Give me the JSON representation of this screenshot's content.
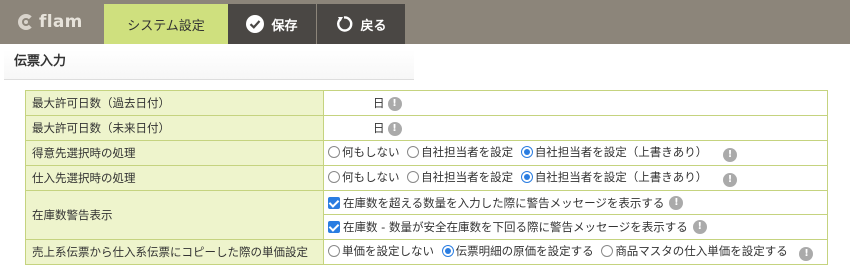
{
  "header": {
    "logo_text": "flam",
    "tab_system": "システム設定",
    "save_label": "保存",
    "back_label": "戻る"
  },
  "section_title": "伝票入力",
  "rows": {
    "max_past": {
      "label": "最大許可日数（過去日付）",
      "unit": "日"
    },
    "max_future": {
      "label": "最大許可日数（未来日付）",
      "unit": "日"
    },
    "customer": {
      "label": "得意先選択時の処理",
      "options": [
        "何もしない",
        "自社担当者を設定",
        "自社担当者を設定（上書きあり）"
      ],
      "selected": 2
    },
    "supplier": {
      "label": "仕入先選択時の処理",
      "options": [
        "何もしない",
        "自社担当者を設定",
        "自社担当者を設定（上書きあり）"
      ],
      "selected": 2
    },
    "stock_warning": {
      "label": "在庫数警告表示",
      "check1": "在庫数を超える数量を入力した際に警告メッセージを表示する",
      "check2": "在庫数 - 数量が安全在庫数を下回る際に警告メッセージを表示する"
    },
    "price_copy": {
      "label": "売上系伝票から仕入系伝票にコピーした際の単価設定",
      "options": [
        "単価を設定しない",
        "伝票明細の原価を設定する",
        "商品マスタの仕入単価を設定する"
      ],
      "selected": 1
    }
  },
  "info_glyph": "!",
  "colors": {
    "accent": "#cfe07e",
    "label_bg": "#eef4cc",
    "border": "#c5d37f",
    "topbar": "#8c857a",
    "button": "#4a4744"
  }
}
